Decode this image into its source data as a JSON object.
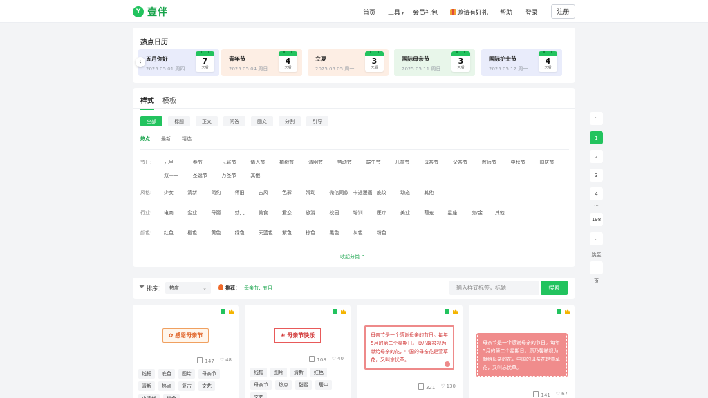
{
  "brand": {
    "logo_mark": "Y",
    "name": "壹伴"
  },
  "nav": {
    "home": "首页",
    "tools": "工具",
    "member": "会员礼包",
    "invite": "邀请有好礼",
    "help": "帮助",
    "login": "登录",
    "register": "注册"
  },
  "hot_calendar": {
    "title": "热点日历",
    "items": [
      {
        "name": "五月你好",
        "date": "2025.05.01",
        "weekday": "周四",
        "days": "7",
        "unit": "天后",
        "bg": "#e9ecfb"
      },
      {
        "name": "青年节",
        "date": "2025.05.04",
        "weekday": "周日",
        "days": "4",
        "unit": "天后",
        "bg": "#fdeee4"
      },
      {
        "name": "立夏",
        "date": "2025.05.05",
        "weekday": "周一",
        "days": "3",
        "unit": "天后",
        "bg": "#fdeee4"
      },
      {
        "name": "国际母亲节",
        "date": "2025.05.11",
        "weekday": "周日",
        "days": "3",
        "unit": "天后",
        "bg": "#e8f6ea"
      },
      {
        "name": "国际护士节",
        "date": "2025.05.12",
        "weekday": "周一",
        "days": "4",
        "unit": "天后",
        "bg": "#e9ecfb"
      }
    ]
  },
  "tabs": [
    "样式",
    "模板"
  ],
  "type_chips": [
    "全部",
    "标题",
    "正文",
    "问答",
    "图文",
    "分割",
    "引导"
  ],
  "sub_tabs": [
    "热点",
    "最新",
    "精选"
  ],
  "filters": {
    "festival": {
      "label": "节日:",
      "row1": [
        "元旦",
        "春节",
        "元宵节",
        "情人节",
        "植树节",
        "清明节",
        "劳动节",
        "端午节",
        "儿童节",
        "母亲节",
        "父亲节",
        "教师节",
        "中秋节",
        "国庆节"
      ],
      "row2": [
        "双十一",
        "圣诞节",
        "万圣节",
        "其他"
      ]
    },
    "style": {
      "label": "风格:",
      "tags": [
        "少女",
        "清新",
        "简约",
        "怀旧",
        "古风",
        "色彩",
        "滑动",
        "微信同款",
        "卡通漫画",
        "底纹",
        "动态",
        "其他"
      ]
    },
    "industry": {
      "label": "行业:",
      "tags": [
        "电商",
        "企业",
        "母婴",
        "幼儿",
        "美食",
        "爱恋",
        "旅游",
        "校园",
        "培训",
        "医疗",
        "美业",
        "萌宠",
        "星座",
        "房/金",
        "其他"
      ]
    },
    "color": {
      "label": "颜色:",
      "tags": [
        "红色",
        "橙色",
        "黄色",
        "绿色",
        "天蓝色",
        "紫色",
        "棕色",
        "黑色",
        "灰色",
        "粉色"
      ]
    }
  },
  "collapse_label": "收起分类 ⌃",
  "sort": {
    "label": "排序：",
    "value": "热度",
    "rec_label": "推荐：",
    "rec_links": [
      "母亲节、",
      "五月"
    ],
    "search_placeholder": "输入样式标签，标题",
    "search_button": "搜索"
  },
  "templates": [
    {
      "preview_text": "感恩母亲节",
      "copies": "147",
      "likes": "48",
      "tags": [
        "线框",
        "底色",
        "图片",
        "母亲节",
        "清新",
        "热点",
        "复古",
        "文艺",
        "小清新",
        "橙色"
      ]
    },
    {
      "preview_text": "母亲节快乐",
      "copies": "108",
      "likes": "40",
      "tags": [
        "线框",
        "图片",
        "清新",
        "红色",
        "母亲节",
        "热点",
        "甜蜜",
        "居中",
        "文艺"
      ]
    },
    {
      "preview_text": "母亲节是一个感谢母亲的节日。每年5月的第二个星期日。康乃馨被视为献给母亲的花，中国的母亲花是萱草花，又叫忘忧草。",
      "copies": "321",
      "likes": "130"
    },
    {
      "preview_text": "母亲节是一个感谢母亲的节日。每年5月的第二个星期日。康乃馨被视为献给母亲的花，中国的母亲花是萱草花，又叫忘忧草。",
      "copies": "141",
      "likes": "67"
    }
  ],
  "pagination": {
    "pages": [
      "1",
      "2",
      "3",
      "4"
    ],
    "dots": "...",
    "last": "198",
    "jump_prefix": "跳至",
    "jump_suffix": "页"
  },
  "colors": {
    "accent": "#22c35e"
  }
}
